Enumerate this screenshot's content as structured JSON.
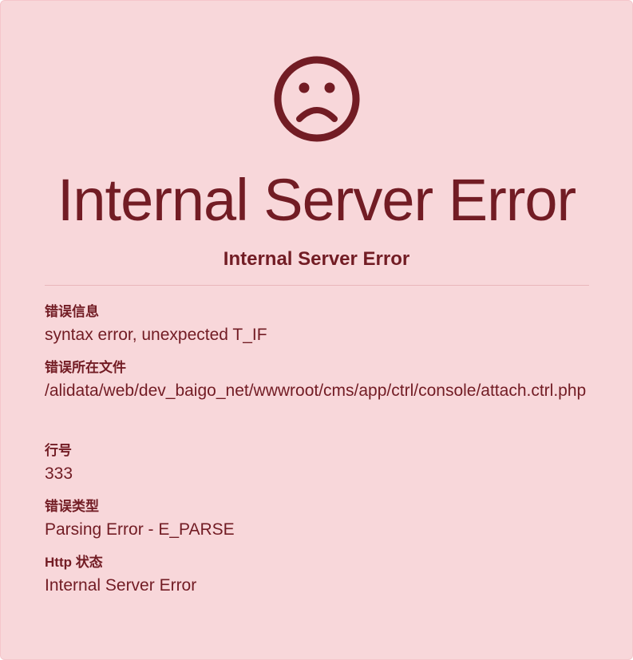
{
  "error": {
    "heading": "Internal Server Error",
    "subheading": "Internal Server Error",
    "fields": [
      {
        "label": "错误信息",
        "value": "syntax error, unexpected T_IF"
      },
      {
        "label": "错误所在文件",
        "value": "/alidata/web/dev_baigo_net/wwwroot/cms/app/ctrl/console/attach.ctrl.php"
      },
      {
        "label": "行号",
        "value": "333"
      },
      {
        "label": "错误类型",
        "value": "Parsing Error - E_PARSE"
      },
      {
        "label": "Http 状态",
        "value": "Internal Server Error"
      }
    ]
  },
  "icon": "sad-face-icon",
  "colors": {
    "background": "#f8d7da",
    "border": "#f5c6cb",
    "text": "#721c24"
  }
}
